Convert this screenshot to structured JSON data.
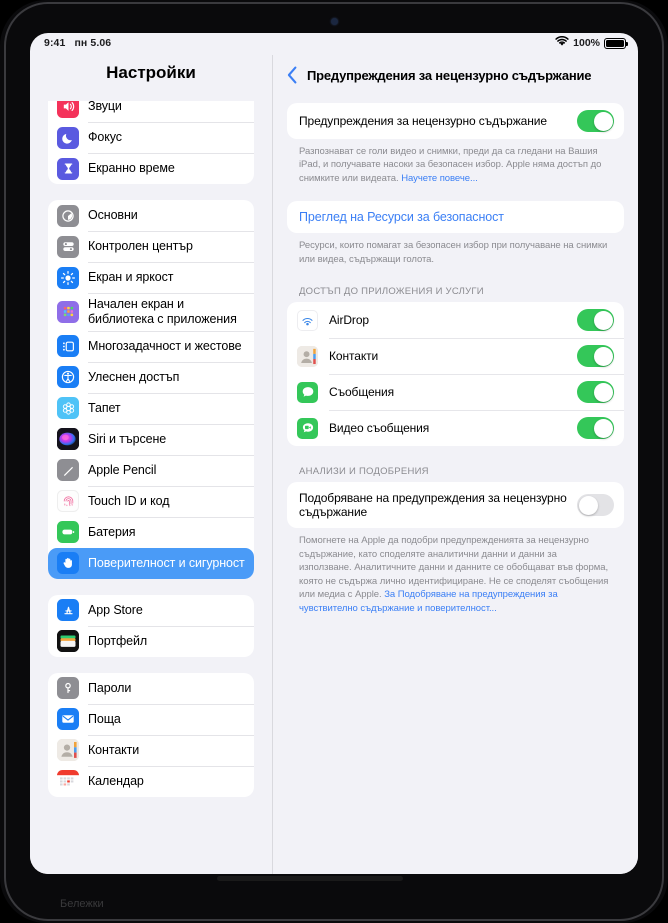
{
  "status_bar": {
    "time": "9:41",
    "date": "пн 5.06",
    "wifi_icon": "wifi-icon",
    "battery_percent": "100%",
    "battery_icon": "battery-full-icon"
  },
  "sidebar": {
    "title": "Настройки",
    "groups": [
      {
        "clipped": true,
        "items": [
          {
            "label": "Звуци",
            "icon": "speaker-waves-icon",
            "selected": false
          },
          {
            "label": "Фокус",
            "icon": "moon-icon",
            "selected": false
          },
          {
            "label": "Екранно време",
            "icon": "hourglass-icon",
            "selected": false
          }
        ]
      },
      {
        "clipped": false,
        "items": [
          {
            "label": "Основни",
            "icon": "gear-icon",
            "selected": false
          },
          {
            "label": "Контролен център",
            "icon": "sliders-icon",
            "selected": false
          },
          {
            "label": "Екран и яркост",
            "icon": "brightness-icon",
            "selected": false
          },
          {
            "label": "Начален екран и библиотека с приложения",
            "icon": "app-grid-icon",
            "selected": false
          },
          {
            "label": "Многозадачност и жестове",
            "icon": "multitasking-icon",
            "selected": false
          },
          {
            "label": "Улеснен достъп",
            "icon": "accessibility-icon",
            "selected": false
          },
          {
            "label": "Тапет",
            "icon": "wallpaper-flower-icon",
            "selected": false
          },
          {
            "label": "Siri и търсене",
            "icon": "siri-icon",
            "selected": false
          },
          {
            "label": "Apple Pencil",
            "icon": "pencil-icon",
            "selected": false
          },
          {
            "label": "Touch ID и код",
            "icon": "fingerprint-icon",
            "selected": false
          },
          {
            "label": "Батерия",
            "icon": "battery-icon",
            "selected": false
          },
          {
            "label": "Поверителност и сигурност",
            "icon": "hand-raised-icon",
            "selected": true
          }
        ]
      },
      {
        "clipped": false,
        "items": [
          {
            "label": "App Store",
            "icon": "app-store-icon",
            "selected": false
          },
          {
            "label": "Портфейл",
            "icon": "wallet-icon",
            "selected": false
          }
        ]
      },
      {
        "clipped": false,
        "items": [
          {
            "label": "Пароли",
            "icon": "key-icon",
            "selected": false
          },
          {
            "label": "Поща",
            "icon": "mail-icon",
            "selected": false
          },
          {
            "label": "Контакти",
            "icon": "contacts-icon",
            "selected": false
          },
          {
            "label": "Календар",
            "icon": "calendar-icon",
            "selected": false
          }
        ]
      }
    ],
    "partial_below_label": "Бележки"
  },
  "detail": {
    "back_icon": "chevron-left-icon",
    "title": "Предупреждения за нецензурно съдържание",
    "main_toggle": {
      "label": "Предупреждения за нецензурно съдържание",
      "state": "on"
    },
    "main_footnote": "Разпознават се голи видео и снимки, преди да са гледани на Вашия iPad, и получавате насоки за безопасен избор. Apple няма достъп до снимките или видеата.",
    "main_footnote_link": "Научете повече...",
    "safety_link": "Преглед на Ресурси за безопасност",
    "safety_footnote": "Ресурси, които помагат за безопасен избор при получаване на снимки или видеа, съдържащи голота.",
    "apps_section_header": "ДОСТЪП ДО ПРИЛОЖЕНИЯ И УСЛУГИ",
    "apps": [
      {
        "label": "AirDrop",
        "icon": "airdrop-icon",
        "state": "on"
      },
      {
        "label": "Контакти",
        "icon": "contacts-icon",
        "state": "on"
      },
      {
        "label": "Съобщения",
        "icon": "messages-icon",
        "state": "on"
      },
      {
        "label": "Видео съобщения",
        "icon": "facetime-video-icon",
        "state": "on"
      }
    ],
    "analytics_section_header": "АНАЛИЗИ И ПОДОБРЕНИЯ",
    "analytics_toggle": {
      "label": "Подобряване на предупреждения за нецензурно съдържание",
      "state": "off"
    },
    "analytics_footnote": "Помогнете на Apple да подобри предупрежденията за нецензурно съдържание, като споделяте аналитични данни и данни за използване. Аналитичните данни и данните се обобщават във форма, която не съдържа лично идентифициране. Не се споделят съобщения или медиа с Apple.",
    "analytics_footnote_link": "За Подобряване на предупреждения за чувствително съдържание и поверителност..."
  },
  "colors": {
    "accent_blue": "#3b7ff5",
    "toggle_on_green": "#34c759",
    "toggle_off_gray": "#e3e3e6",
    "selected_row_blue": "#4a9bf7",
    "screen_bg": "#f2f2f7"
  }
}
